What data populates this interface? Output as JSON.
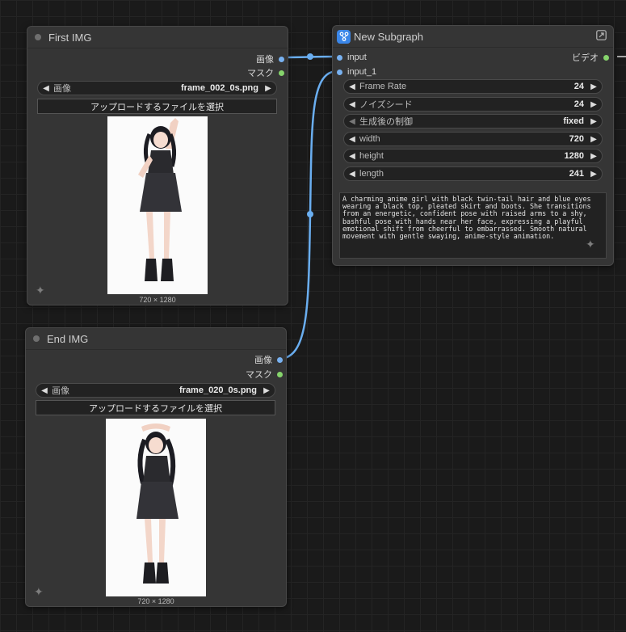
{
  "first_img": {
    "title": "First IMG",
    "out_image": "画像",
    "out_mask": "マスク",
    "widget_label": "画像",
    "widget_value": "frame_002_0s.png",
    "upload_label": "アップロードするファイルを選択",
    "dims": "720 × 1280"
  },
  "end_img": {
    "title": "End IMG",
    "out_image": "画像",
    "out_mask": "マスク",
    "widget_label": "画像",
    "widget_value": "frame_020_0s.png",
    "upload_label": "アップロードするファイルを選択",
    "dims": "720 × 1280"
  },
  "subgraph": {
    "title": "New Subgraph",
    "input_0": "input",
    "input_1": "input_1",
    "output_0": "ビデオ",
    "widgets": [
      {
        "label": "Frame Rate",
        "value": "24"
      },
      {
        "label": "ノイズシード",
        "value": "24"
      },
      {
        "label": "生成後の制御",
        "value": "fixed"
      },
      {
        "label": "width",
        "value": "720"
      },
      {
        "label": "height",
        "value": "1280"
      },
      {
        "label": "length",
        "value": "241"
      }
    ],
    "prompt": "A charming anime girl with black twin-tail hair and blue eyes wearing a black top, pleated skirt and boots. She transitions from an energetic, confident pose with raised arms to a shy, bashful pose with hands near her face, expressing a playful emotional shift from cheerful to embarrassed. Smooth natural movement with gentle swaying, anime-style animation."
  },
  "colors": {
    "link": "#6aaef0",
    "image_socket": "#78b1f0",
    "mask_socket": "#86d46c",
    "node_bg": "#353535",
    "canvas_bg": "#1a1a1a"
  },
  "icons": {
    "subgraph": "subgraph-icon",
    "expand": "expand-icon",
    "sparkle": "sparkle-icon"
  }
}
